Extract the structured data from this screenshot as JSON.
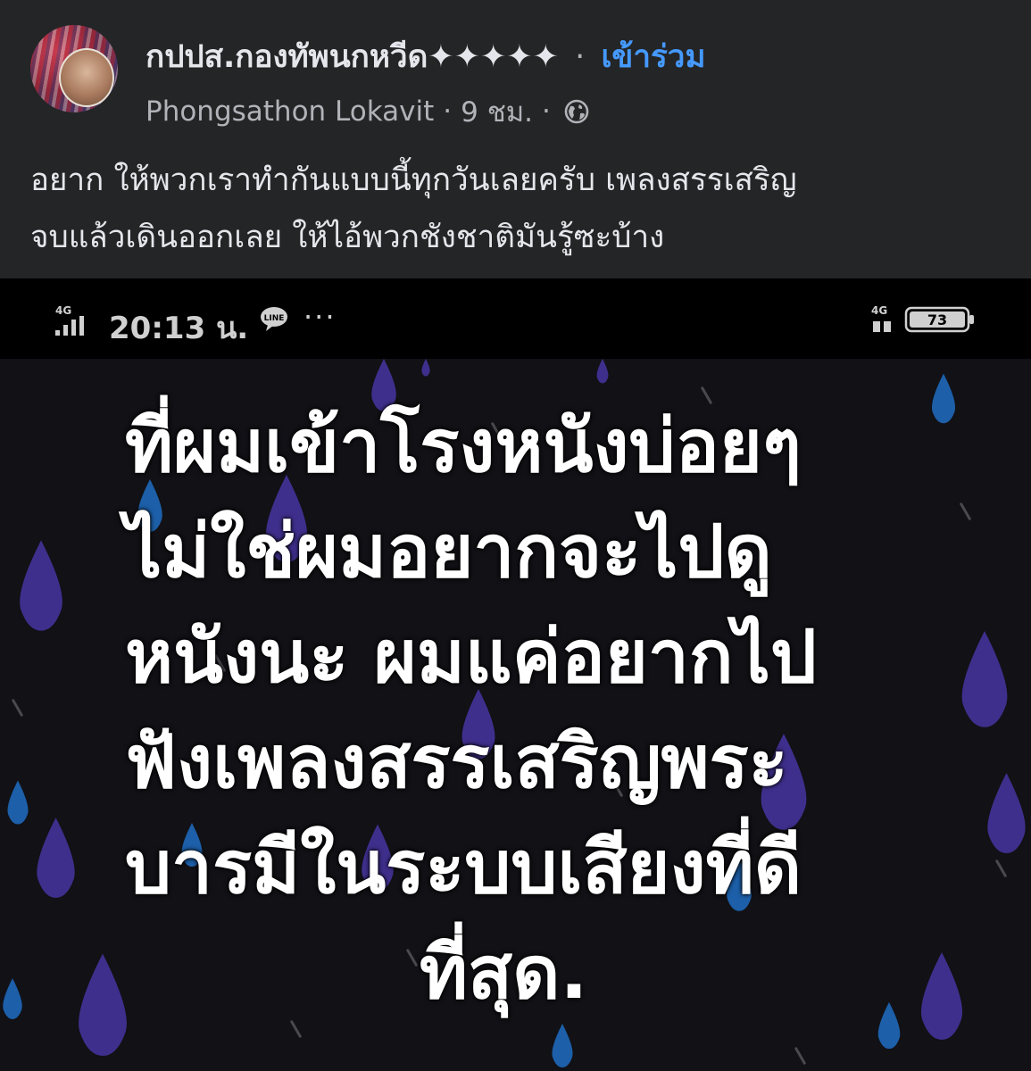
{
  "post": {
    "group_name": "กปปส.กองทัพนกหวีด✦✦✦✦✦",
    "separator": "·",
    "join_label": "เข้าร่วม",
    "author": "Phongsathon Lokavit",
    "time": "9 ชม.",
    "privacy_icon": "globe-icon",
    "text_lines": [
      "อยาก ให้พวกเราทำกันแบบนี้ทุกวันเลยครับ เพลงสรรเสริญ",
      "จบแล้วเดินออกเลย ให้ไอ้พวกชังชาติมันรู้ซะบ้าง"
    ]
  },
  "image": {
    "status_bar": {
      "network_left": "4G",
      "time": "20:13 น.",
      "more": "···",
      "network_right": "4G",
      "battery": "73"
    },
    "quote_lines": [
      "ที่ผมเข้าโรงหนังบ่อยๆ",
      "ไม่ใช่ผมอยากจะไปดู",
      "หนังนะ ผมแค่อยากไป",
      "ฟังเพลงสรรเสริญพระ",
      "บารมีในระบบเสียงที่ดี",
      "ที่สุด."
    ]
  },
  "colors": {
    "background": "#242526",
    "link": "#4599ff",
    "secondary_text": "#b0b3b8",
    "drop_purple": "#3f2f8c",
    "drop_blue": "#1d5fa8"
  }
}
